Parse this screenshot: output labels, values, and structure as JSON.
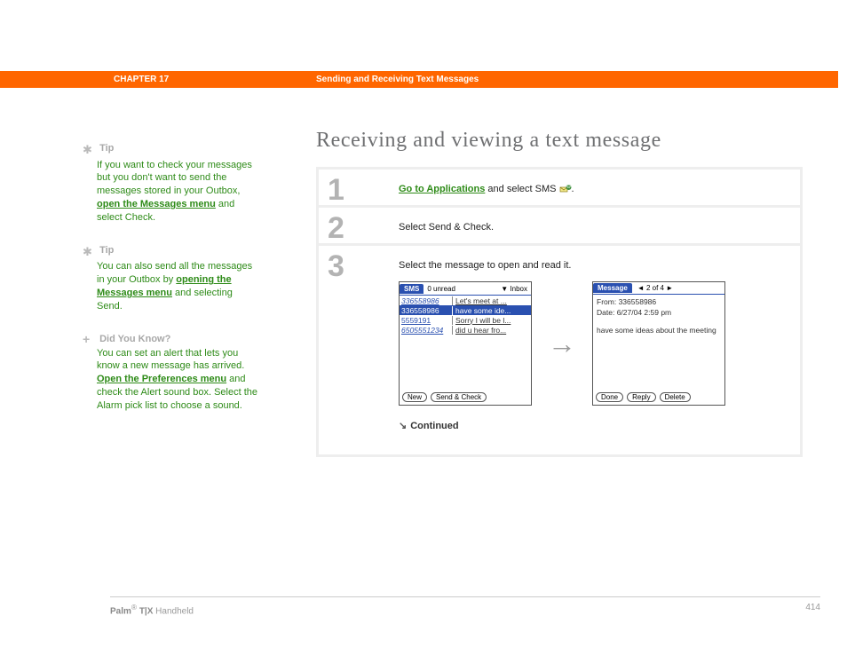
{
  "header": {
    "chapter": "CHAPTER 17",
    "title": "Sending and Receiving Text Messages"
  },
  "sidebar": {
    "tip1": {
      "label": "Tip",
      "pre": "If you want to check your messages but you don't want to send the messages stored in your Outbox, ",
      "link": "open the Messages menu",
      "post": " and select Check."
    },
    "tip2": {
      "label": "Tip",
      "pre": "You can also send all the messages in your Outbox by ",
      "link": "opening the Messages menu",
      "post": " and selecting Send."
    },
    "dyk": {
      "label": "Did You Know?",
      "pre": "You can set an alert that lets you know a new message has arrived. ",
      "link": "Open the Preferences menu",
      "post": " and check the Alert sound box. Select the Alarm pick list to choose a sound."
    }
  },
  "main": {
    "heading": "Receiving and viewing a text message"
  },
  "steps": {
    "s1": {
      "num": "1",
      "link": "Go to Applications",
      "post": " and select SMS ",
      "tail": "."
    },
    "s2": {
      "num": "2",
      "text": "Select Send & Check."
    },
    "s3": {
      "num": "3",
      "text": "Select the message to open and read it."
    }
  },
  "inbox": {
    "tab": "SMS",
    "unread": "0 unread",
    "dropdownArrow": "▼",
    "dropdown": "Inbox",
    "rows": [
      {
        "from": "336558986",
        "preview": "Let's meet at ...",
        "sel": false,
        "italic": true
      },
      {
        "from": "336558986",
        "preview": "have some ide...",
        "sel": true,
        "italic": false
      },
      {
        "from": "5559191",
        "preview": "Sorry I will be l...",
        "sel": false,
        "italic": false
      },
      {
        "from": "6505551234",
        "preview": "did u hear fro...",
        "sel": false,
        "italic": true
      }
    ],
    "btnNew": "New",
    "btnSendCheck": "Send & Check"
  },
  "message": {
    "tab": "Message",
    "navL": "◄",
    "nav": "2 of 4",
    "navR": "►",
    "fromLabel": "From:",
    "from": "336558986",
    "dateLabel": "Date:",
    "date": "6/27/04 2:59 pm",
    "body": "have some ideas about the meeting",
    "btnDone": "Done",
    "btnReply": "Reply",
    "btnDelete": "Delete"
  },
  "continued": "Continued",
  "footer": {
    "brand1": "Palm",
    "reg": "®",
    "brand2": " T|X",
    "tail": " Handheld",
    "page": "414"
  }
}
